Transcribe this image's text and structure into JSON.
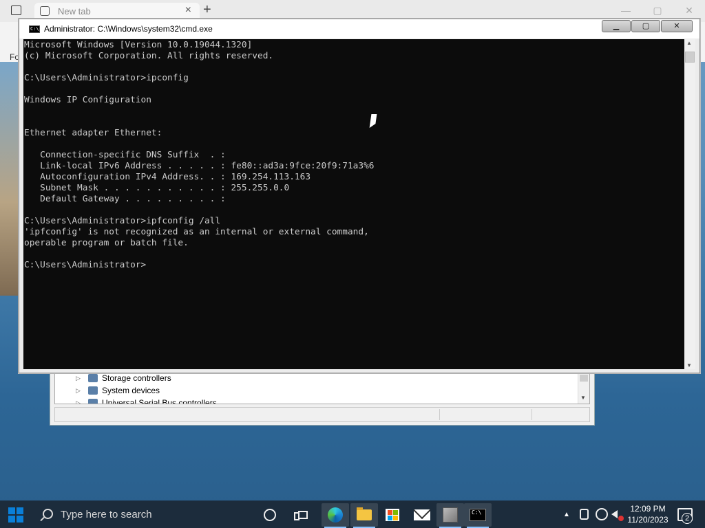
{
  "browser": {
    "tab_label": "New tab",
    "tab_close": "×",
    "new_tab": "+",
    "win_minimize": "—",
    "win_restore": "▢",
    "win_close": "✕",
    "sidebar_fragment": "Fo"
  },
  "device_manager": {
    "items": [
      {
        "label": "Storage controllers",
        "icon": "storage-controller-icon"
      },
      {
        "label": "System devices",
        "icon": "system-devices-icon"
      },
      {
        "label": "Universal Serial Bus controllers",
        "icon": "usb-controller-icon"
      }
    ]
  },
  "cmd": {
    "title": "Administrator: C:\\Windows\\system32\\cmd.exe",
    "icon_text": "C:\\",
    "minimize_label": "▁",
    "maximize_label": "▢",
    "close_label": "✕",
    "output": "Microsoft Windows [Version 10.0.19044.1320]\n(c) Microsoft Corporation. All rights reserved.\n\nC:\\Users\\Administrator>ipconfig\n\nWindows IP Configuration\n\n\nEthernet adapter Ethernet:\n\n   Connection-specific DNS Suffix  . :\n   Link-local IPv6 Address . . . . . : fe80::ad3a:9fce:20f9:71a3%6\n   Autoconfiguration IPv4 Address. . : 169.254.113.163\n   Subnet Mask . . . . . . . . . . . : 255.255.0.0\n   Default Gateway . . . . . . . . . :\n\nC:\\Users\\Administrator>ipfconfig /all\n'ipfconfig' is not recognized as an internal or external command,\noperable program or batch file.\n\nC:\\Users\\Administrator>"
  },
  "taskbar": {
    "search_placeholder": "Type here to search",
    "pinned": [
      {
        "name": "cortana-icon"
      },
      {
        "name": "task-view-icon"
      },
      {
        "name": "edge-icon"
      },
      {
        "name": "file-explorer-icon"
      },
      {
        "name": "microsoft-store-icon"
      },
      {
        "name": "mail-icon"
      },
      {
        "name": "network-app-icon"
      },
      {
        "name": "command-prompt-icon"
      }
    ],
    "tray": {
      "chevron": "▲",
      "time": "12:09 PM",
      "date": "11/20/2023",
      "notification_count": "2"
    }
  }
}
